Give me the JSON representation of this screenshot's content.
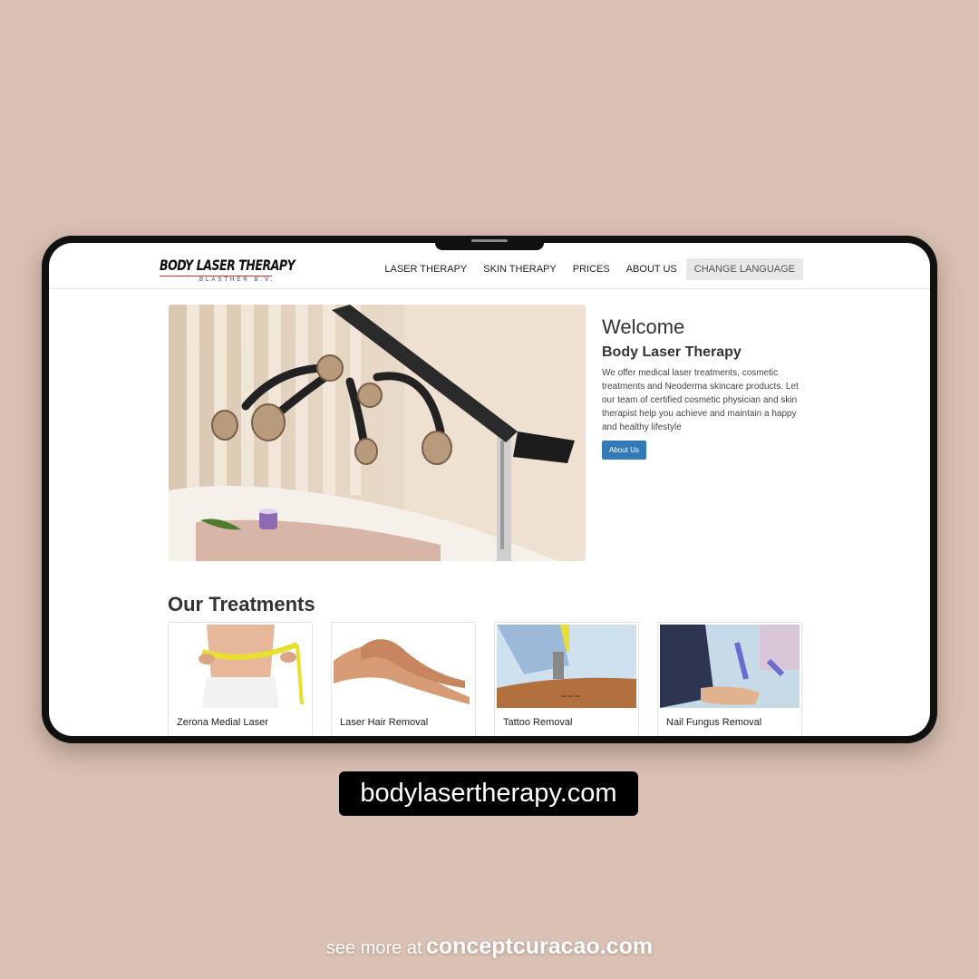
{
  "site": {
    "logo_title": "BODY LASER THERAPY",
    "logo_sub": "BLASTHER B.V.",
    "nav": [
      "LASER THERAPY",
      "SKIN THERAPY",
      "PRICES",
      "ABOUT US"
    ],
    "change_language": "CHANGE LANGUAGE"
  },
  "hero": {
    "title": "Welcome",
    "subtitle": "Body Laser Therapy",
    "text": "We offer medical laser treatments, cosmetic treatments and Neoderma skincare products. Let our team of certified cosmetic physician and skin therapist help you achieve and maintain a happy and healthy lifestyle",
    "button": "About Us"
  },
  "treatments": {
    "title": "Our Treatments",
    "items": [
      "Zerona Medial Laser",
      "Laser Hair Removal",
      "Tattoo Removal",
      "Nail Fungus Removal"
    ]
  },
  "promo": {
    "url": "bodylasertherapy.com",
    "footer_lead": "see more at",
    "footer_site": "conceptcuracao.com"
  },
  "colors": {
    "background": "#dbc1b3",
    "button": "#337ab7"
  }
}
